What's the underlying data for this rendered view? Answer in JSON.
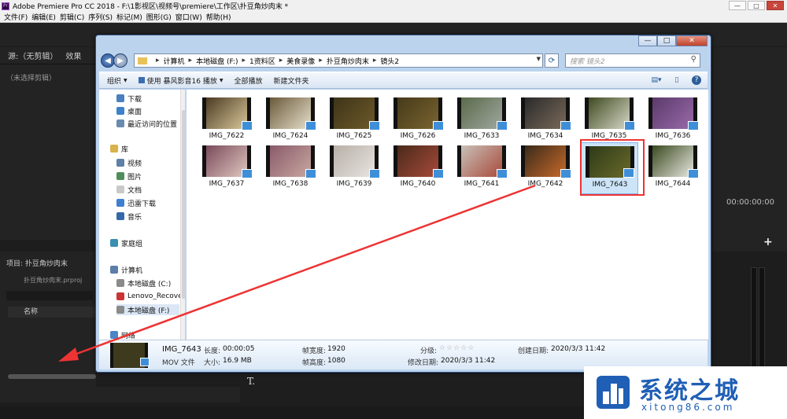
{
  "app": {
    "title": "Adobe Premiere Pro CC 2018 - F:\\1影视区\\视频号\\premiere\\工作区\\扑豆角炒肉末 *",
    "menu": [
      "文件(F)",
      "编辑(E)",
      "剪辑(C)",
      "序列(S)",
      "标记(M)",
      "图形(G)",
      "窗口(W)",
      "帮助(H)"
    ]
  },
  "source_panel": {
    "tab_source": "源:（无剪辑）",
    "tab_effects": "效果",
    "no_clip": "（未选择剪辑）"
  },
  "project_panel": {
    "title": "项目: 扑豆角炒肉末",
    "subtitle": "扑豆角炒肉末.prproj",
    "name_col": "名称"
  },
  "right_panel": {
    "timecode": "00:00:00:00"
  },
  "explorer": {
    "address": [
      "计算机",
      "本地磁盘 (F:)",
      "1资料区",
      "美食录像",
      "扑豆角炒肉末",
      "镜头2"
    ],
    "search_placeholder": "搜索 镜头2",
    "toolbar": {
      "organize": "组织",
      "play_with": "使用 暴风影音16 播放",
      "play_all": "全部播放",
      "new_folder": "新建文件夹"
    },
    "nav": [
      {
        "label": "下载",
        "icon": "download-folder-icon"
      },
      {
        "label": "桌面",
        "icon": "desktop-icon"
      },
      {
        "label": "最近访问的位置",
        "icon": "recent-places-icon"
      },
      {
        "label": "库",
        "icon": "library-icon"
      },
      {
        "label": "视频",
        "icon": "video-library-icon"
      },
      {
        "label": "图片",
        "icon": "picture-library-icon"
      },
      {
        "label": "文档",
        "icon": "document-library-icon"
      },
      {
        "label": "迅雷下载",
        "icon": "thunder-download-icon"
      },
      {
        "label": "音乐",
        "icon": "music-library-icon"
      },
      {
        "label": "家庭组",
        "icon": "homegroup-icon"
      },
      {
        "label": "计算机",
        "icon": "computer-icon"
      },
      {
        "label": "本地磁盘 (C:)",
        "icon": "drive-c-icon"
      },
      {
        "label": "Lenovo_Recove",
        "icon": "recovery-drive-icon"
      },
      {
        "label": "本地磁盘 (F:)",
        "icon": "drive-f-icon"
      },
      {
        "label": "网络",
        "icon": "network-icon"
      }
    ],
    "files": [
      "IMG_7622",
      "IMG_7624",
      "IMG_7625",
      "IMG_7626",
      "IMG_7633",
      "IMG_7634",
      "IMG_7635",
      "IMG_7636",
      "IMG_7637",
      "IMG_7638",
      "IMG_7639",
      "IMG_7640",
      "IMG_7641",
      "IMG_7642",
      "IMG_7643",
      "IMG_7644"
    ],
    "selected": "IMG_7643",
    "details": {
      "name": "IMG_7643",
      "type": "MOV 文件",
      "length_label": "长度:",
      "length": "00:00:05",
      "size_label": "大小:",
      "size": "16.9 MB",
      "width_label": "帧宽度:",
      "width": "1920",
      "height_label": "帧高度:",
      "height": "1080",
      "rating_label": "分级:",
      "rating_stars": "☆☆☆☆☆",
      "modified_label": "修改日期:",
      "modified": "2020/3/3 11:42",
      "created_label": "创建日期:",
      "created": "2020/3/3 11:42"
    }
  },
  "watermark": {
    "title": "系统之城",
    "url": "xitong86.com"
  },
  "colors": {
    "accent": "#1f5fb5",
    "highlight": "#e33333"
  }
}
